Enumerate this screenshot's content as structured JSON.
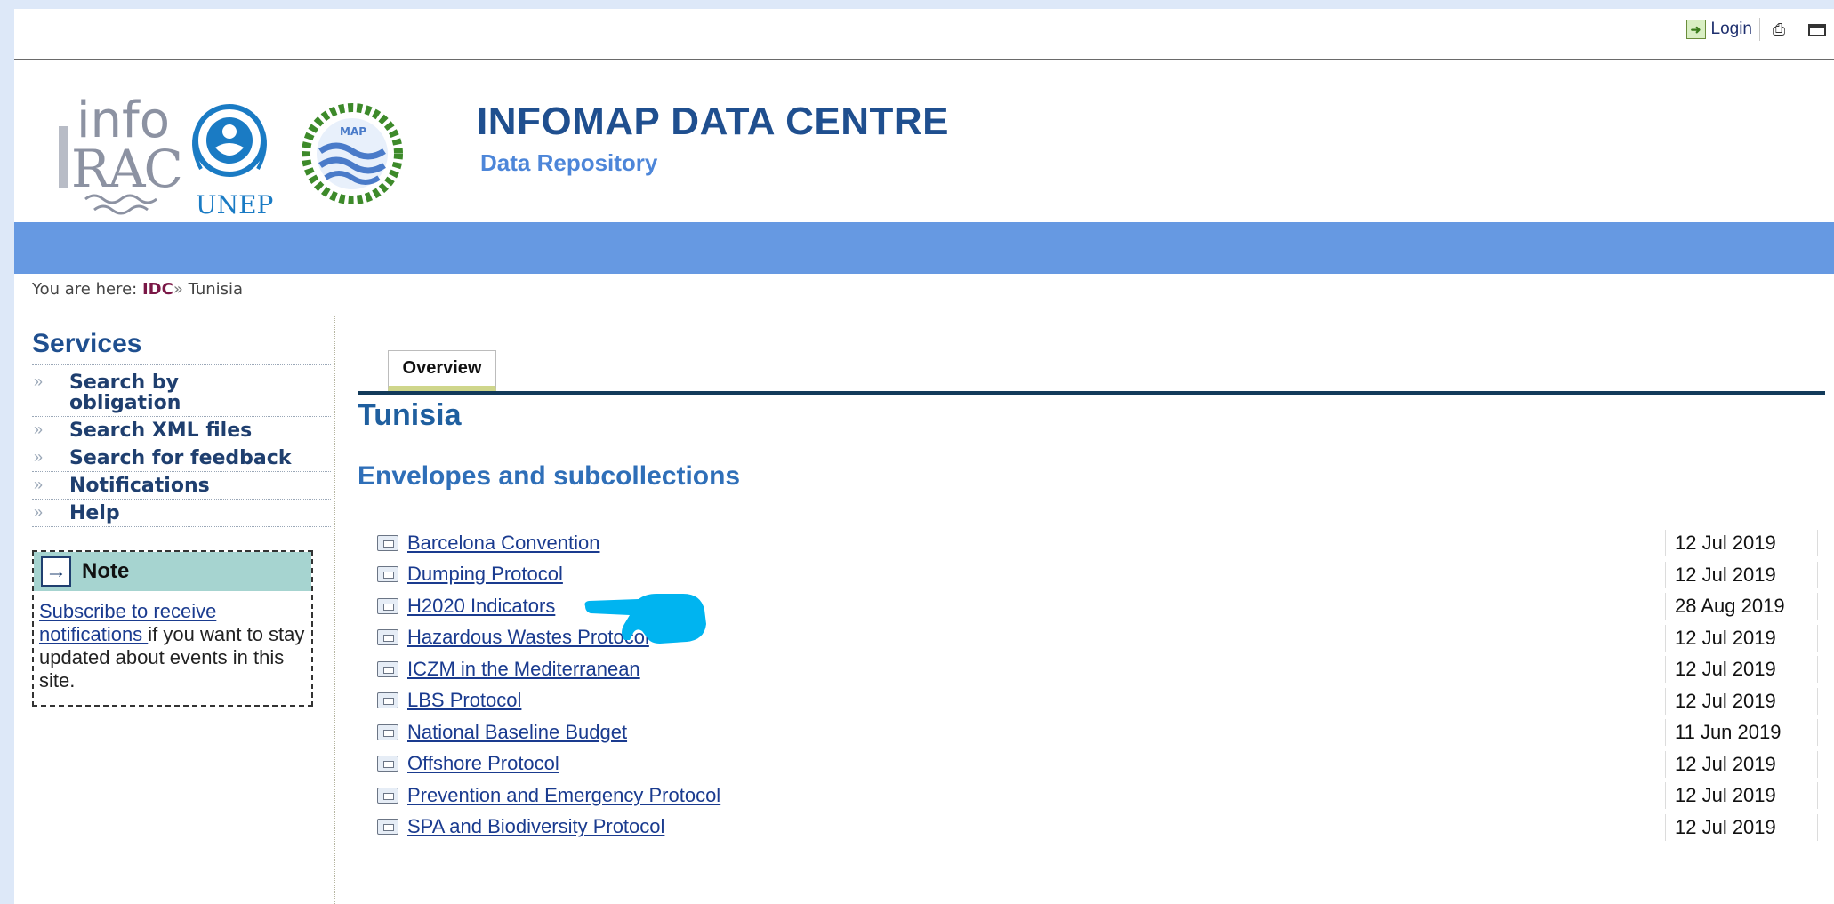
{
  "topbar": {
    "login_label": "Login",
    "icons": [
      "login-icon",
      "print-icon",
      "fullscreen-icon"
    ]
  },
  "header": {
    "title": "INFOMAP DATA CENTRE",
    "subtitle": "Data Repository",
    "logo_info_top": "info",
    "logo_info_bottom": "RAC",
    "logo_unep_text": "UNEP",
    "logo_map_text": "MAP"
  },
  "breadcrumb": {
    "prefix": "You are here:",
    "root": "IDC",
    "separator": "»",
    "current": "Tunisia"
  },
  "sidebar": {
    "title": "Services",
    "bullet": "»",
    "items": [
      {
        "label": "Search by obligation"
      },
      {
        "label": "Search XML files"
      },
      {
        "label": "Search for feedback"
      },
      {
        "label": "Notifications"
      },
      {
        "label": "Help"
      }
    ],
    "note": {
      "title": "Note",
      "link_text": "Subscribe to receive notifications ",
      "body_text": "if you want to stay updated about events in this site."
    }
  },
  "main": {
    "tabs": [
      {
        "label": "Overview"
      }
    ],
    "title": "Tunisia",
    "section_title": "Envelopes and subcollections",
    "envelopes": [
      {
        "name": "Barcelona Convention",
        "date": "12 Jul 2019"
      },
      {
        "name": "Dumping Protocol",
        "date": "12 Jul 2019"
      },
      {
        "name": "H2020 Indicators",
        "date": "28 Aug 2019"
      },
      {
        "name": "Hazardous Wastes Protocol",
        "date": "12 Jul 2019"
      },
      {
        "name": "ICZM in the Mediterranean",
        "date": "12 Jul 2019"
      },
      {
        "name": "LBS Protocol",
        "date": "12 Jul 2019"
      },
      {
        "name": "National Baseline Budget",
        "date": "11 Jun 2019"
      },
      {
        "name": "Offshore Protocol",
        "date": "12 Jul 2019"
      },
      {
        "name": "Prevention and Emergency Protocol",
        "date": "12 Jul 2019"
      },
      {
        "name": "SPA and Biodiversity Protocol",
        "date": "12 Jul 2019"
      }
    ]
  },
  "colors": {
    "band": "#6699e2",
    "title_blue": "#1f4f8f",
    "pointer": "#00b4f0"
  }
}
